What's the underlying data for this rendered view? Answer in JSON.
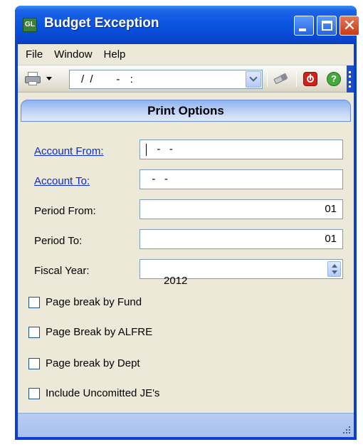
{
  "window": {
    "title": "Budget Exception",
    "icon_name": "app-gl-icon",
    "icon_text": "GL",
    "controls": {
      "minimize_icon": "minimize-icon",
      "maximize_icon": "maximize-icon",
      "close_icon": "close-icon",
      "close_glyph": "✕"
    }
  },
  "menu": [
    {
      "label": "File"
    },
    {
      "label": "Window"
    },
    {
      "label": "Help"
    }
  ],
  "toolbar": {
    "print_icon": "printer-icon",
    "date_combo_value": "/ /     -  :",
    "eraser_icon": "eraser-icon",
    "stop_icon": "stop-icon",
    "help_icon": "help-icon",
    "help_glyph": "?"
  },
  "section": {
    "title": "Print Options"
  },
  "fields": {
    "account_from": {
      "label": "Account From:",
      "value": "  -   -"
    },
    "account_to": {
      "label": "Account To:",
      "value": "  -   -"
    },
    "period_from": {
      "label": "Period From:",
      "value": "01"
    },
    "period_to": {
      "label": "Period To:",
      "value": "01"
    },
    "fiscal_year": {
      "label": "Fiscal Year:",
      "value": "2012"
    }
  },
  "checkboxes": [
    {
      "label": "Page break by Fund",
      "checked": false
    },
    {
      "label": "Page Break by ALFRE",
      "checked": false
    },
    {
      "label": "Page break by Dept",
      "checked": false
    },
    {
      "label": "Include Uncomitted JE's",
      "checked": false
    }
  ],
  "colors": {
    "title_bar": "#0a54e0",
    "window_bg": "#ece9d8",
    "link": "#0a2ad6",
    "status_bar": "#a9c0ee"
  }
}
